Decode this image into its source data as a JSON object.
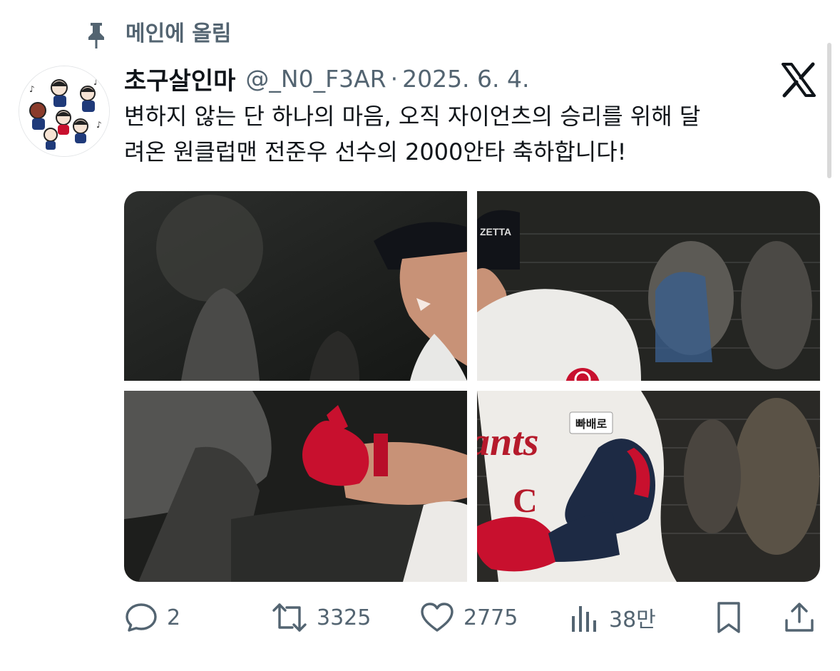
{
  "pinned": {
    "label": "메인에 올림",
    "icon": "pin-icon"
  },
  "tweet": {
    "display_name": "초구살인마",
    "handle": "@_N0_F3AR",
    "separator": "·",
    "date": "2025. 6. 4.",
    "text_lines": [
      "변하지 않는 단 하나의 마음, 오직 자이언츠의 승리를 위해 달",
      "려온 원클럽맨 전준우 선수의 2000안타 축하합니다!"
    ],
    "media_count": 4
  },
  "actions": {
    "reply": {
      "icon": "reply-icon",
      "count": "2"
    },
    "retweet": {
      "icon": "retweet-icon",
      "count": "3325"
    },
    "like": {
      "icon": "heart-icon",
      "count": "2775"
    },
    "views": {
      "icon": "views-icon",
      "count": "38만"
    },
    "bookmark": {
      "icon": "bookmark-icon"
    },
    "share": {
      "icon": "share-icon"
    }
  },
  "brand": {
    "logo": "x-logo-icon",
    "accent": "#0f1419",
    "muted": "#536471",
    "jersey_red": "#c8102e"
  }
}
